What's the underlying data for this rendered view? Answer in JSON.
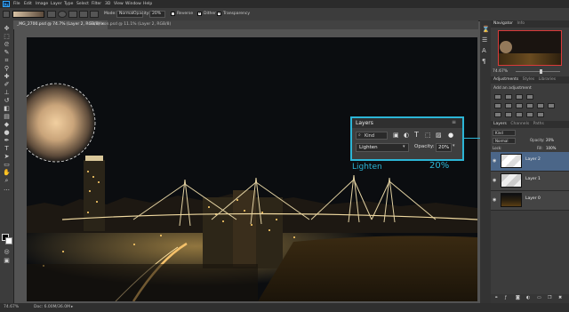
{
  "menubar": {
    "logo": "Ps",
    "items": [
      "File",
      "Edit",
      "Image",
      "Layer",
      "Type",
      "Select",
      "Filter",
      "3D",
      "View",
      "Window",
      "Help"
    ]
  },
  "options": {
    "mode_label": "Mode:",
    "mode_value": "Normal",
    "opacity_label": "Opacity:",
    "opacity_value": "20%",
    "reverse_label": "Reverse",
    "dither_label": "Dither",
    "transparency_label": "Transparency"
  },
  "tabs": [
    {
      "label": "_MG_2700.psd @ 74.7% (Layer 2, RGB/8) ×",
      "active": true
    },
    {
      "label": "Full Moon.psd @ 11.1% (Layer 2, RGB/8)",
      "active": false
    }
  ],
  "status": {
    "zoom": "74.67%",
    "doc": "Doc: 6.00M/36.0M"
  },
  "navigator": {
    "tabs": [
      "Navigator",
      "Info"
    ],
    "zoom": "74.67%"
  },
  "adjustments": {
    "tabs": [
      "Adjustments",
      "Styles",
      "Libraries"
    ],
    "hint": "Add an adjustment"
  },
  "layers_panel": {
    "tabs": [
      "Layers",
      "Channels",
      "Paths"
    ],
    "kind": "Kind",
    "blend": "Normal",
    "opacity_label": "Opacity:",
    "opacity": "20%",
    "lock_label": "Lock:",
    "fill_label": "Fill:",
    "fill": "100%",
    "layers": [
      {
        "name": "Layer 2",
        "selected": true
      },
      {
        "name": "Layer 1",
        "selected": false
      },
      {
        "name": "Layer 0",
        "selected": false
      }
    ]
  },
  "callout": {
    "title": "Layers",
    "kind": "Kind",
    "blend": "Lighten",
    "opacity_label": "Opacity:",
    "opacity": "20%",
    "big_label": "Lighten",
    "big_pct": "20%"
  },
  "colors": {
    "accent": "#2cb5d6",
    "selected_layer": "#4b6688"
  }
}
